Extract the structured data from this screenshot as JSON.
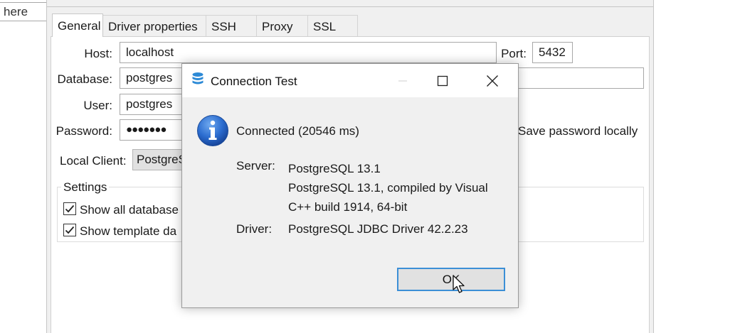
{
  "left_stub": {
    "text": "here"
  },
  "tabs": [
    {
      "label": "General",
      "active": true
    },
    {
      "label": "Driver properties",
      "active": false
    },
    {
      "label": "SSH",
      "active": false
    },
    {
      "label": "Proxy",
      "active": false
    },
    {
      "label": "SSL",
      "active": false
    }
  ],
  "form": {
    "host_label": "Host:",
    "host_value": "localhost",
    "port_label": "Port:",
    "port_value": "5432",
    "database_label": "Database:",
    "database_value": "postgres",
    "user_label": "User:",
    "user_value": "postgres",
    "password_label": "Password:",
    "password_value": "●●●●●●●",
    "save_password_label": "Save password locally",
    "local_client_label": "Local Client:",
    "local_client_value": "PostgreS"
  },
  "settings": {
    "title": "Settings",
    "show_all_databases": "Show all database",
    "show_template_databases": "Show template da"
  },
  "dialog": {
    "title": "Connection Test",
    "status": "Connected (20546 ms)",
    "server_label": "Server:",
    "server_line1": "PostgreSQL 13.1",
    "server_line2": "PostgreSQL 13.1, compiled by Visual",
    "server_line3": "C++ build 1914, 64-bit",
    "driver_label": "Driver:",
    "driver_value": "PostgreSQL JDBC Driver 42.2.23",
    "ok_label": "OK"
  },
  "icons": {
    "dialog_icon": "database-icon",
    "info": "info-icon",
    "minimize": "minimize-icon",
    "maximize": "maximize-icon",
    "close": "close-icon",
    "checkbox": "checkmark-icon",
    "cursor": "mouse-pointer-icon"
  },
  "colors": {
    "accent_blue": "#3c8fd6",
    "info_blue": "#1e5bb8",
    "panel_bg": "#f0f0f0"
  }
}
